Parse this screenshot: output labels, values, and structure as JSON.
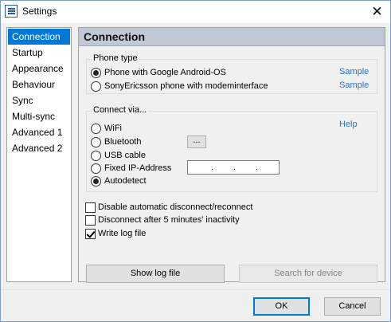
{
  "window": {
    "title": "Settings",
    "close_glyph": "✕",
    "icon": "settings-list-icon"
  },
  "sidebar": {
    "items": [
      {
        "label": "Connection",
        "selected": true
      },
      {
        "label": "Startup"
      },
      {
        "label": "Appearance"
      },
      {
        "label": "Behaviour"
      },
      {
        "label": "Sync"
      },
      {
        "label": "Multi-sync"
      },
      {
        "label": "Advanced 1"
      },
      {
        "label": "Advanced 2"
      }
    ]
  },
  "panel": {
    "title": "Connection",
    "phone_type": {
      "legend": "Phone type",
      "options": [
        {
          "label": "Phone with Google Android-OS",
          "checked": true,
          "link": "Sample"
        },
        {
          "label": "SonyEricsson phone with modeminterface",
          "checked": false,
          "link": "Sample"
        }
      ]
    },
    "connect_via": {
      "legend": "Connect via...",
      "help_link": "Help",
      "options": [
        {
          "label": "WiFi",
          "checked": false
        },
        {
          "label": "Bluetooth",
          "checked": false
        },
        {
          "label": "USB cable",
          "checked": false
        },
        {
          "label": "Fixed IP-Address",
          "checked": false
        },
        {
          "label": "Autodetect",
          "checked": true
        }
      ],
      "bluetooth_browse_label": "...",
      "ip_separator": "."
    },
    "checkboxes": [
      {
        "label": "Disable automatic disconnect/reconnect",
        "checked": false
      },
      {
        "label": "Disconnect after 5 minutes' inactivity",
        "checked": false
      },
      {
        "label": "Write log file",
        "checked": true
      }
    ],
    "show_log_label": "Show log file",
    "search_device_label": "Search for device"
  },
  "footer": {
    "ok_label": "OK",
    "cancel_label": "Cancel"
  },
  "colors": {
    "selection": "#0078d7",
    "link": "#2a72c8",
    "header_band": "#c1c9d6"
  }
}
